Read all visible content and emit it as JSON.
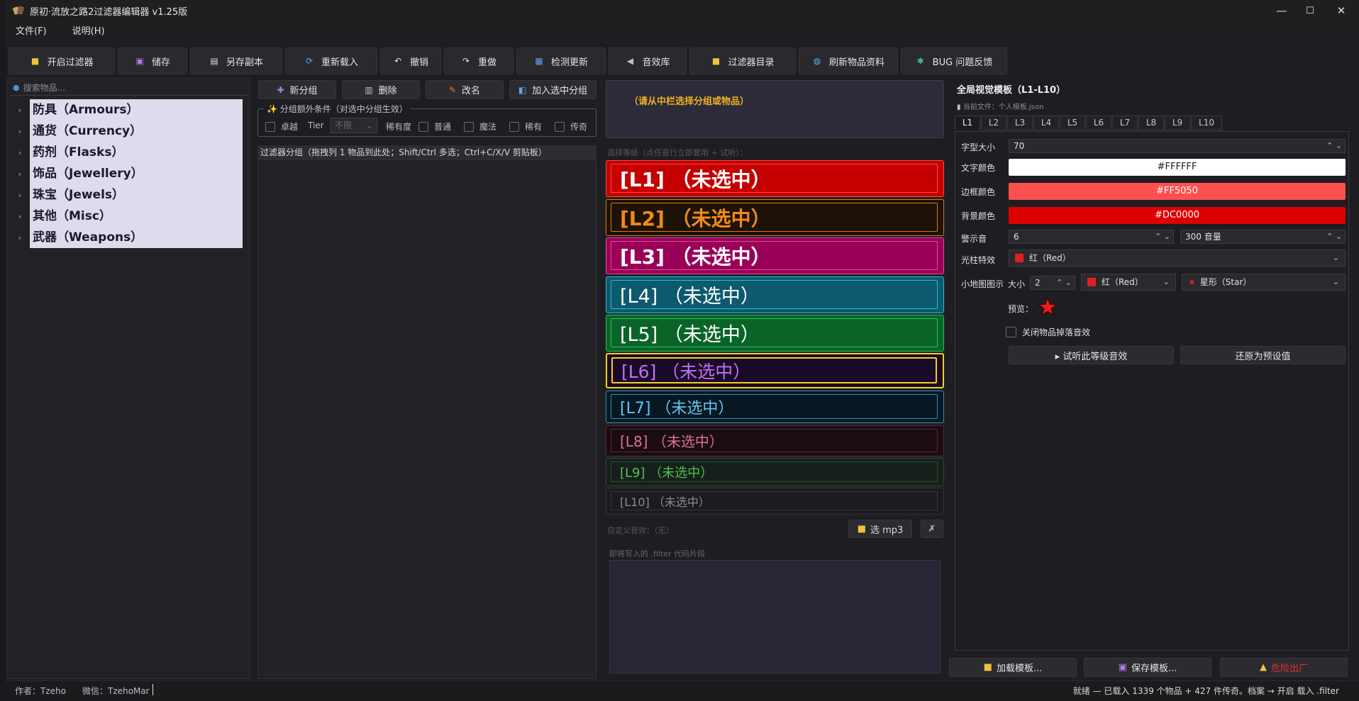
{
  "window": {
    "title": "原初·流放之路2过滤器编辑器 v1.25版",
    "min_glyph": "—",
    "max_glyph": "☐",
    "close_glyph": "✕"
  },
  "menu": {
    "file": "文件(F)",
    "help": "说明(H)"
  },
  "toolbar": {
    "open": "开启过滤器",
    "save": "储存",
    "save_copy": "另存副本",
    "reload": "重新载入",
    "undo": "撤销",
    "redo": "重做",
    "check_update": "检测更新",
    "sound_lib": "音效库",
    "filter_dir": "过滤器目录",
    "refresh_items": "刷新物品资料",
    "bug_report": "BUG 问题反馈"
  },
  "left": {
    "search_placeholder": "搜索物品...",
    "categories": [
      "防具（Armours）",
      "通货（Currency）",
      "药剂（Flasks）",
      "饰品（Jewellery）",
      "珠宝（Jewels）",
      "其他（Misc）",
      "武器（Weapons）"
    ]
  },
  "middle": {
    "add_group": "新分组",
    "delete": "删除",
    "rename": "改名",
    "add_to_group": "加入选中分组",
    "conditions_legend": "分组额外条件（对选中分组生效）",
    "cond_exceptional": "卓越",
    "cond_tier_label": "Tier",
    "cond_tier_value": "不限",
    "cond_rarity": "稀有度",
    "cond_normal": "普通",
    "cond_magic": "魔法",
    "cond_rare": "稀有",
    "cond_unique": "传奇",
    "group_header": "过滤器分组（拖拽列 1 物品到此处；Shift/Ctrl 多选；Ctrl+C/X/V 剪贴板）"
  },
  "center": {
    "hint": "（请从中栏选择分组或物品）",
    "level_caption": "选择等级（点任意行立即套用 + 试听）：",
    "levels": [
      "[L1] （未选中）",
      "[L2] （未选中）",
      "[L3] （未选中）",
      "[L4] （未选中）",
      "[L5] （未选中）",
      "[L6] （未选中）",
      "[L7] （未选中）",
      "[L8] （未选中）",
      "[L9] （未选中）",
      "[L10] （未选中）"
    ],
    "custom_sound": "自定义音效：（无）",
    "mp3_btn": "选 mp3",
    "clear_btn": "✗",
    "code_caption": "即将写入的 .filter 代码片段"
  },
  "right": {
    "title": "全局视觉模板（L1-L10）",
    "file": "当前文件：个人模板.json",
    "tabs": [
      "L1",
      "L2",
      "L3",
      "L4",
      "L5",
      "L6",
      "L7",
      "L8",
      "L9",
      "L10"
    ],
    "font_size_label": "字型大小",
    "font_size": "70",
    "text_color_label": "文字颜色",
    "text_color": "#FFFFFF",
    "border_color_label": "边框颜色",
    "border_color": "#FF5050",
    "bg_color_label": "背景颜色",
    "bg_color": "#DC0000",
    "alert_label": "警示音",
    "alert_value": "6",
    "volume_value": "300 音量",
    "beam_label": "光柱特效",
    "beam_value": "红（Red）",
    "minimap_label": "小地图图示",
    "size_label": "大小",
    "size_value": "2",
    "minimap_color": "红（Red）",
    "minimap_shape": "星形（Star）",
    "preview_label": "预览：",
    "mute_drop": "关闭物品掉落音效",
    "preview_sound": "▸ 试听此等级音效",
    "reset_default": "还原为预设值",
    "load_template": "加载模板...",
    "save_template": "保存模板...",
    "danger_btn": "危险出厂"
  },
  "status": {
    "author": "作者：Tzeho",
    "wechat": "微信：TzehoMar",
    "ready": "就绪 — 已载入 1339 个物品 + 427 件传奇。档案 → 开启 载入 .filter"
  },
  "colors": {
    "L1_bg": "#c40000",
    "L1_border": "#ff4848",
    "L1_text": "#ffffff",
    "L2_bg": "#1c1208",
    "L2_border": "#e07a10",
    "L2_text": "#f08a18",
    "L3_bg": "#9a0058",
    "L3_border": "#e04aa0",
    "L3_text": "#ffffff",
    "L4_bg": "#0c5a6e",
    "L4_border": "#30b8d8",
    "L4_text": "#ffffff",
    "L5_bg": "#0a6428",
    "L5_border": "#30c060",
    "L5_text": "#ffffff",
    "L6_bg": "#1a0a2a",
    "L6_border": "#f0d020",
    "L6_text": "#c070f0",
    "L7_bg": "#081822",
    "L7_border": "#3090c0",
    "L7_text": "#60c8f0",
    "L8_bg": "#1a0c10",
    "L8_border": "#5a2a34",
    "L8_text": "#e07090",
    "L9_bg": "#16201a",
    "L9_border": "#34443a",
    "L9_text": "#50c050",
    "L10_bg": "#1c1c20",
    "L10_border": "#34343a",
    "L10_text": "#8a8a92"
  }
}
